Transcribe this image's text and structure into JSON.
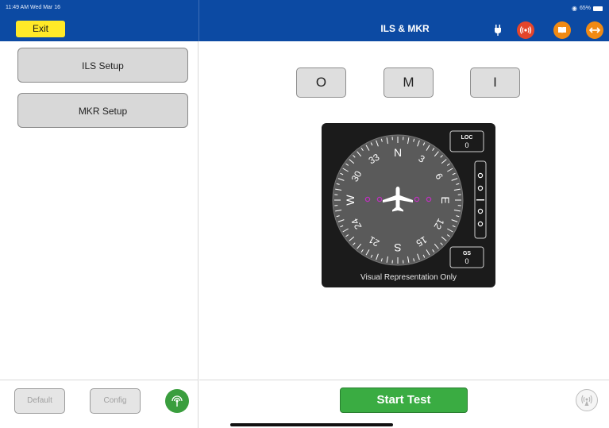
{
  "status": {
    "time": "11:49 AM  Wed Mar 16",
    "battery": "65%"
  },
  "header": {
    "exit_label": "Exit",
    "title": "ILS & MKR",
    "icons": [
      "plug-icon",
      "radio-wave-icon",
      "book-icon",
      "swap-arrows-icon"
    ]
  },
  "sidebar": {
    "ils_setup_label": "ILS Setup",
    "mkr_setup_label": "MKR Setup",
    "default_label": "Default",
    "config_label": "Config",
    "green_icon": "antenna-signal-icon"
  },
  "markers": {
    "outer": "O",
    "middle": "M",
    "inner": "I"
  },
  "instrument": {
    "compass_labels": [
      "N",
      "3",
      "6",
      "E",
      "12",
      "15",
      "S",
      "21",
      "24",
      "W",
      "30",
      "33"
    ],
    "loc_label": "LOC",
    "loc_value": "0",
    "gs_label": "GS",
    "gs_value": "0",
    "caption": "Visual Representation Only"
  },
  "footer": {
    "start_label": "Start Test",
    "right_icon": "wireless-antenna-icon"
  },
  "colors": {
    "header": "#0c4aa3",
    "exit": "#ffe928",
    "start": "#3aac42",
    "orange": "#f08a14",
    "red": "#e5452b",
    "magenta": "#c030c0"
  }
}
